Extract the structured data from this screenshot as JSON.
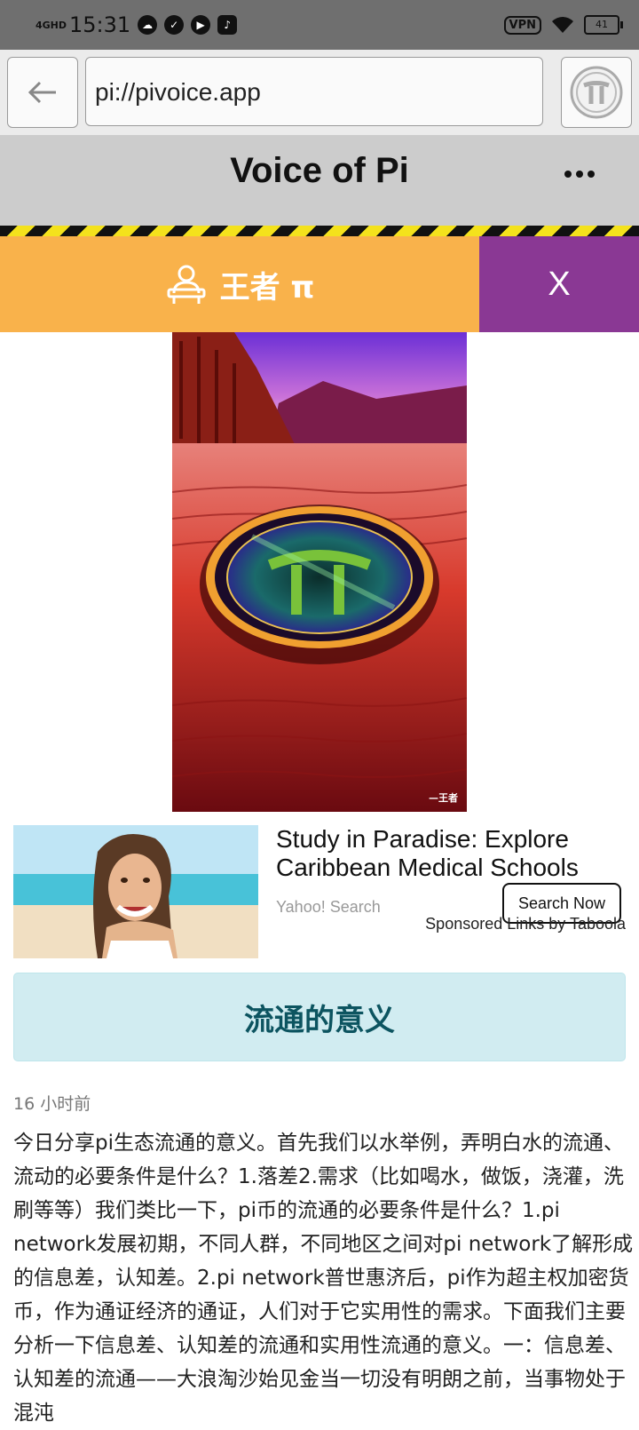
{
  "status_bar": {
    "network": "4GHD",
    "time": "15:31",
    "vpn": "VPN",
    "battery": "41"
  },
  "browser": {
    "url": "pi://pivoice.app"
  },
  "app": {
    "title": "Voice of Pi"
  },
  "user_bar": {
    "name": "王者 π",
    "close_label": "X"
  },
  "hero_image": {
    "signature": "—王者"
  },
  "ad": {
    "title": "Study in Paradise: Explore Caribbean Medical Schools",
    "source": "Yahoo! Search",
    "cta": "Search Now",
    "sponsor_note": "Sponsored Links by Taboola"
  },
  "post": {
    "title": "流通的意义",
    "time_ago": "16 小时前",
    "body": "今日分享pi生态流通的意义。首先我们以水举例，弄明白水的流通、流动的必要条件是什么？1.落差2.需求（比如喝水，做饭，浇灌，洗刷等等）我们类比一下，pi币的流通的必要条件是什么？1.pi network发展初期，不同人群，不同地区之间对pi network了解形成的信息差，认知差。2.pi network普世惠济后，pi作为超主权加密货币，作为通证经济的通证，人们对于它实用性的需求。下面我们主要分析一下信息差、认知差的流通和实用性流通的意义。一：信息差、认知差的流通——大浪淘沙始见金当一切没有明朗之前，当事物处于混沌"
  },
  "colors": {
    "user_bar": "#f9b24b",
    "close_tab": "#8a3894",
    "title_card_bg": "#d1ecf1",
    "title_card_text": "#0c5460"
  }
}
